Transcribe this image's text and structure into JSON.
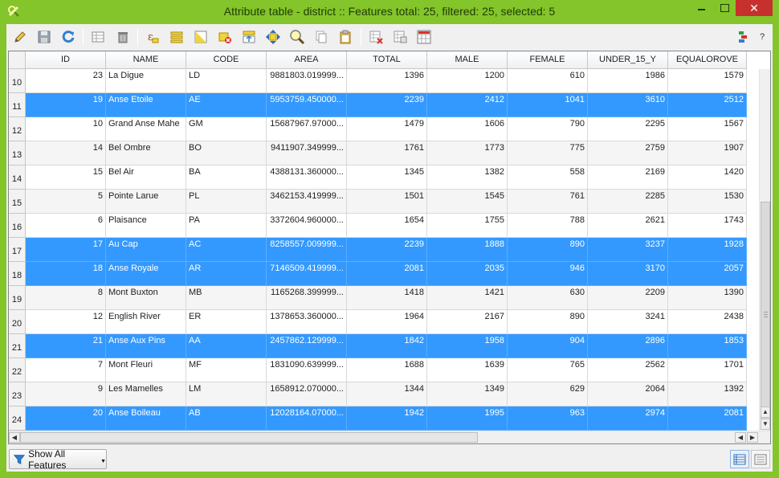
{
  "window": {
    "title": "Attribute table - district :: Features total: 25, filtered: 25, selected: 5",
    "close_label": "✕"
  },
  "toolbar": {
    "left_icons": [
      "pencil-icon",
      "save-edits-icon",
      "reload-icon",
      "delete-selected-icon",
      "delete-feature-icon",
      "expression-select-icon",
      "select-all-icon",
      "invert-selection-icon",
      "deselect-all-icon",
      "move-selection-top-icon",
      "pan-to-selected-icon",
      "zoom-to-selected-icon",
      "copy-selected-icon",
      "paste-features-icon",
      "delete-column-icon",
      "new-column-icon",
      "field-calculator-icon"
    ],
    "right_icons": [
      "dock-icon"
    ],
    "help_label": "?"
  },
  "table": {
    "columns": [
      "ID",
      "NAME",
      "CODE",
      "AREA",
      "TOTAL",
      "MALE",
      "FEMALE",
      "UNDER_15_Y",
      "EQUALOROVE"
    ],
    "rows": [
      {
        "n": "10",
        "sel": false,
        "cells": [
          "23",
          "La Digue",
          "LD",
          "9881803.019999...",
          "1396",
          "1200",
          "610",
          "1986",
          "1579"
        ]
      },
      {
        "n": "11",
        "sel": true,
        "cells": [
          "19",
          "Anse Etoile",
          "AE",
          "5953759.450000...",
          "2239",
          "2412",
          "1041",
          "3610",
          "2512"
        ]
      },
      {
        "n": "12",
        "sel": false,
        "cells": [
          "10",
          "Grand Anse Mahe",
          "GM",
          "15687967.97000...",
          "1479",
          "1606",
          "790",
          "2295",
          "1567"
        ]
      },
      {
        "n": "13",
        "sel": false,
        "cells": [
          "14",
          "Bel Ombre",
          "BO",
          "9411907.349999...",
          "1761",
          "1773",
          "775",
          "2759",
          "1907"
        ]
      },
      {
        "n": "14",
        "sel": false,
        "cells": [
          "15",
          "Bel Air",
          "BA",
          "4388131.360000...",
          "1345",
          "1382",
          "558",
          "2169",
          "1420"
        ]
      },
      {
        "n": "15",
        "sel": false,
        "cells": [
          "5",
          "Pointe Larue",
          "PL",
          "3462153.419999...",
          "1501",
          "1545",
          "761",
          "2285",
          "1530"
        ]
      },
      {
        "n": "16",
        "sel": false,
        "cells": [
          "6",
          "Plaisance",
          "PA",
          "3372604.960000...",
          "1654",
          "1755",
          "788",
          "2621",
          "1743"
        ]
      },
      {
        "n": "17",
        "sel": true,
        "cells": [
          "17",
          "Au Cap",
          "AC",
          "8258557.009999...",
          "2239",
          "1888",
          "890",
          "3237",
          "1928"
        ]
      },
      {
        "n": "18",
        "sel": true,
        "cells": [
          "18",
          "Anse Royale",
          "AR",
          "7146509.419999...",
          "2081",
          "2035",
          "946",
          "3170",
          "2057"
        ]
      },
      {
        "n": "19",
        "sel": false,
        "cells": [
          "8",
          "Mont Buxton",
          "MB",
          "1165268.399999...",
          "1418",
          "1421",
          "630",
          "2209",
          "1390"
        ]
      },
      {
        "n": "20",
        "sel": false,
        "cells": [
          "12",
          "English River",
          "ER",
          "1378653.360000...",
          "1964",
          "2167",
          "890",
          "3241",
          "2438"
        ]
      },
      {
        "n": "21",
        "sel": true,
        "cells": [
          "21",
          "Anse Aux Pins",
          "AA",
          "2457862.129999...",
          "1842",
          "1958",
          "904",
          "2896",
          "1853"
        ]
      },
      {
        "n": "22",
        "sel": false,
        "cells": [
          "7",
          "Mont Fleuri",
          "MF",
          "1831090.639999...",
          "1688",
          "1639",
          "765",
          "2562",
          "1701"
        ]
      },
      {
        "n": "23",
        "sel": false,
        "cells": [
          "9",
          "Les Mamelles",
          "LM",
          "1658912.070000...",
          "1344",
          "1349",
          "629",
          "2064",
          "1392"
        ]
      },
      {
        "n": "24",
        "sel": true,
        "cells": [
          "20",
          "Anse Boileau",
          "AB",
          "12028164.07000...",
          "1942",
          "1995",
          "963",
          "2974",
          "2081"
        ]
      }
    ]
  },
  "footer": {
    "filter_label": "Show All Features",
    "view_buttons": [
      "table-view-icon",
      "form-view-icon"
    ]
  },
  "colors": {
    "frame": "#83c52a",
    "selection": "#3399ff",
    "close": "#c7312d"
  }
}
